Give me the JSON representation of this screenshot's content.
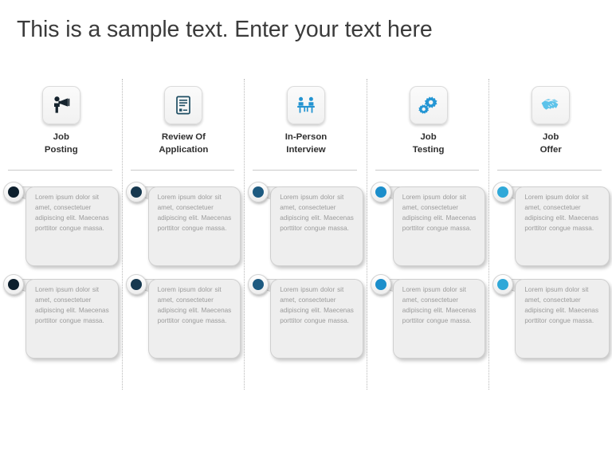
{
  "slide": {
    "title": "This is a sample text. Enter your text here",
    "background_color": "#ffffff",
    "title_color": "#3b3b3b"
  },
  "body_text": "Lorem  ipsum dolor sit amet, consectetuer adipiscing elit. Maecenas porttitor congue massa.",
  "colors": {
    "dot_1": "#0d1f2d",
    "dot_2": "#16384f",
    "dot_3": "#1d5a80",
    "dot_4": "#1b8ecb",
    "dot_5": "#2fa8d8",
    "icon_1": "#16242e",
    "icon_2": "#1f4e63",
    "icon_3": "#2494d1",
    "icon_4": "#2496d4",
    "icon_5": "#5cc3ea",
    "card_fill": "#eeeeee",
    "card_border": "#cfcfcf",
    "card_text": "#9b9b9b",
    "rule": "#c9c9c9",
    "divider": "#b9b9b9"
  },
  "columns": [
    {
      "id": "job-posting",
      "label": "Job\nPosting",
      "icon": "megaphone-person-icon",
      "dot_color": "#0d1f2d",
      "icon_color": "#16242e",
      "cards": [
        {
          "text": "Lorem  ipsum dolor sit amet, consectetuer adipiscing elit. Maecenas porttitor congue massa."
        },
        {
          "text": "Lorem  ipsum dolor sit amet, consectetuer adipiscing elit. Maecenas porttitor congue massa."
        }
      ]
    },
    {
      "id": "review-of-application",
      "label": "Review Of\nApplication",
      "icon": "document-review-icon",
      "dot_color": "#16384f",
      "icon_color": "#1f4e63",
      "cards": [
        {
          "text": "Lorem  ipsum dolor sit amet, consectetuer adipiscing elit. Maecenas porttitor congue massa."
        },
        {
          "text": "Lorem  ipsum dolor sit amet, consectetuer adipiscing elit. Maecenas porttitor congue massa."
        }
      ]
    },
    {
      "id": "in-person-interview",
      "label": "In-Person\nInterview",
      "icon": "two-people-table-icon",
      "dot_color": "#1d5a80",
      "icon_color": "#2494d1",
      "cards": [
        {
          "text": "Lorem  ipsum dolor sit amet, consectetuer adipiscing elit. Maecenas porttitor congue massa."
        },
        {
          "text": "Lorem  ipsum dolor sit amet, consectetuer adipiscing elit. Maecenas porttitor congue massa."
        }
      ]
    },
    {
      "id": "job-testing",
      "label": "Job\nTesting",
      "icon": "gears-icon",
      "dot_color": "#1b8ecb",
      "icon_color": "#2496d4",
      "cards": [
        {
          "text": "Lorem  ipsum dolor sit amet, consectetuer adipiscing elit. Maecenas porttitor congue massa."
        },
        {
          "text": "Lorem  ipsum dolor sit amet, consectetuer adipiscing elit. Maecenas porttitor congue massa."
        }
      ]
    },
    {
      "id": "job-offer",
      "label": "Job\nOffer",
      "icon": "handshake-icon",
      "dot_color": "#2fa8d8",
      "icon_color": "#5cc3ea",
      "cards": [
        {
          "text": "Lorem  ipsum dolor sit amet, consectetuer adipiscing elit. Maecenas porttitor congue massa."
        },
        {
          "text": "Lorem  ipsum dolor sit amet, consectetuer adipiscing elit. Maecenas porttitor congue massa."
        }
      ]
    }
  ]
}
